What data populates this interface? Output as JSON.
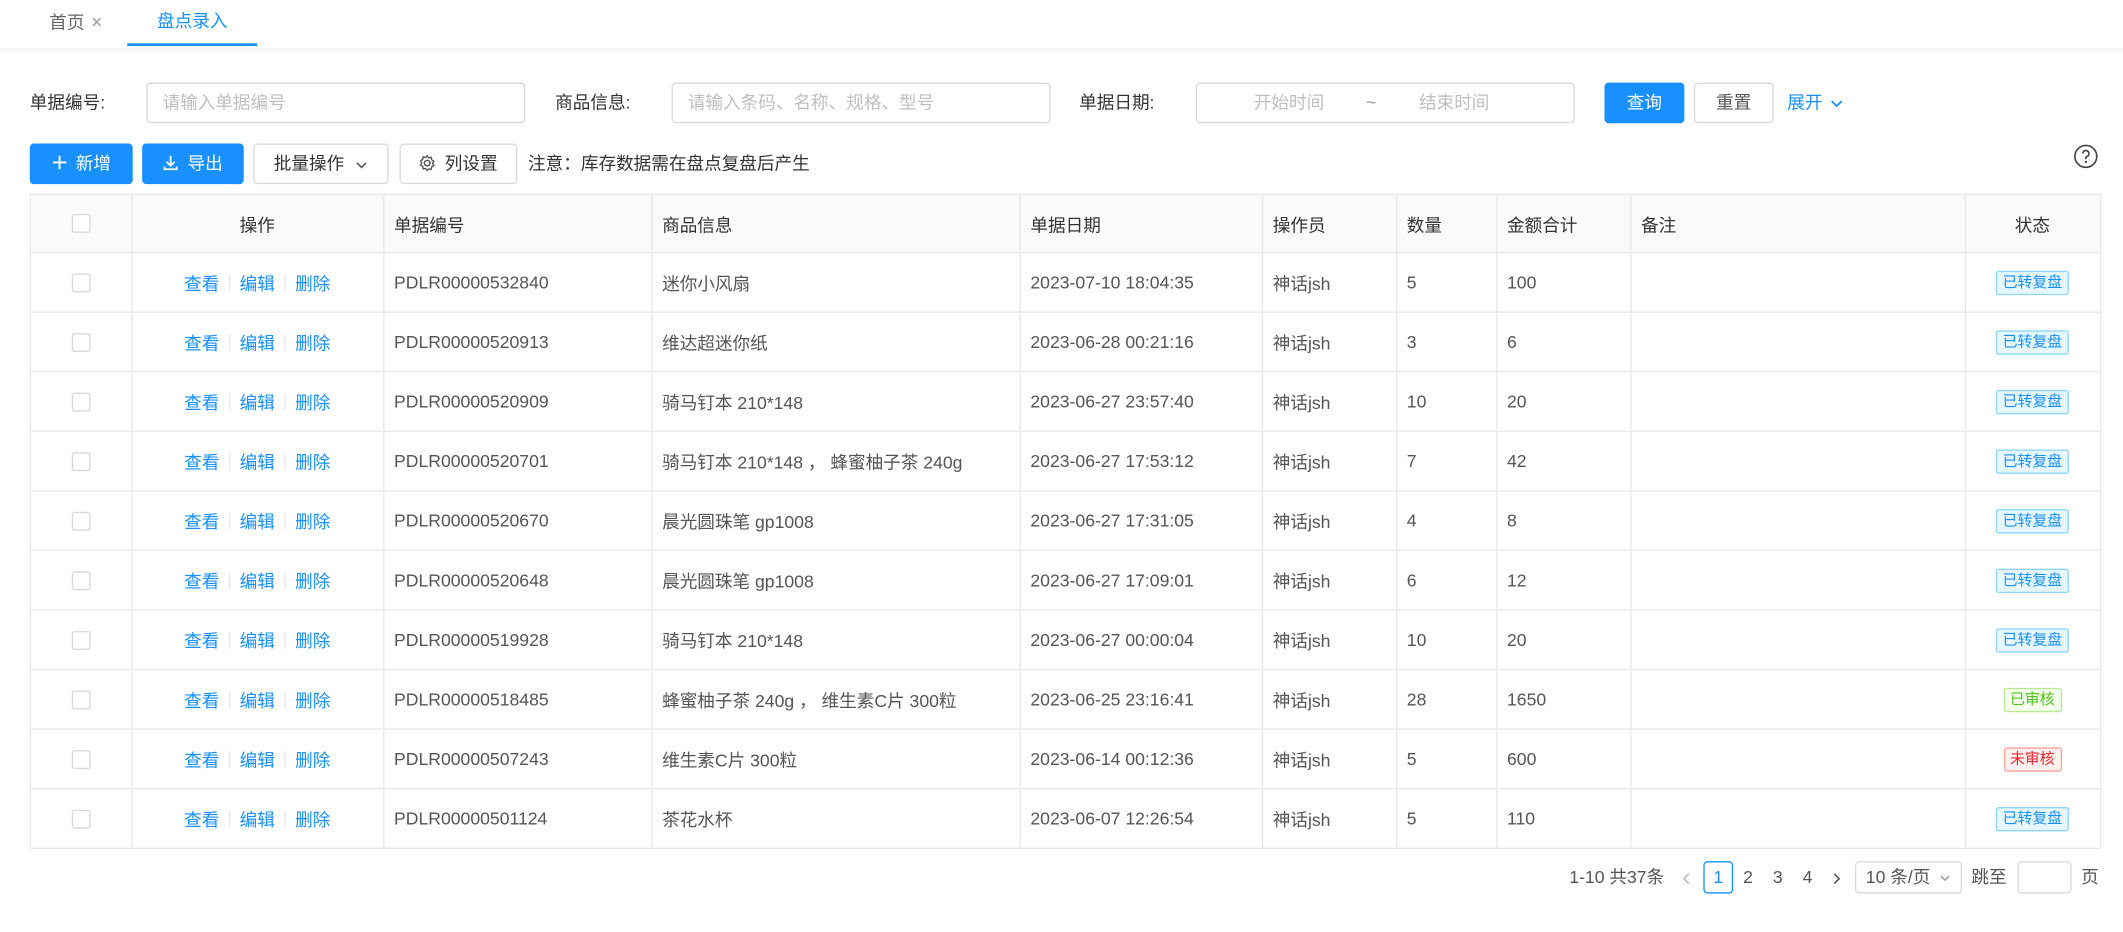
{
  "tabs": [
    {
      "label": "首页"
    },
    {
      "label": "盘点录入"
    }
  ],
  "search": {
    "bill_no_label": "单据编号:",
    "bill_no_placeholder": "请输入单据编号",
    "goods_label": "商品信息:",
    "goods_placeholder": "请输入条码、名称、规格、型号",
    "date_label": "单据日期:",
    "start_placeholder": "开始时间",
    "range_sep": "~",
    "end_placeholder": "结束时间",
    "query_label": "查询",
    "reset_label": "重置",
    "expand_label": "展开"
  },
  "toolbar": {
    "add_label": "新增",
    "export_label": "导出",
    "batch_label": "批量操作",
    "columns_label": "列设置",
    "notice": "注意：库存数据需在盘点复盘后产生"
  },
  "table": {
    "headers": {
      "op": "操作",
      "bill_no": "单据编号",
      "goods": "商品信息",
      "date": "单据日期",
      "operator": "操作员",
      "qty": "数量",
      "amount": "金额合计",
      "remark": "备注",
      "status": "状态"
    },
    "actions": {
      "view": "查看",
      "edit": "编辑",
      "delete": "删除"
    },
    "rows": [
      {
        "bill_no": "PDLR00000532840",
        "goods": "迷你小风扇",
        "date": "2023-07-10 18:04:35",
        "operator": "神话jsh",
        "qty": "5",
        "amount": "100",
        "remark": "",
        "status": "已转复盘",
        "status_color": "blue"
      },
      {
        "bill_no": "PDLR00000520913",
        "goods": "维达超迷你纸",
        "date": "2023-06-28 00:21:16",
        "operator": "神话jsh",
        "qty": "3",
        "amount": "6",
        "remark": "",
        "status": "已转复盘",
        "status_color": "blue"
      },
      {
        "bill_no": "PDLR00000520909",
        "goods": "骑马钉本 210*148",
        "date": "2023-06-27 23:57:40",
        "operator": "神话jsh",
        "qty": "10",
        "amount": "20",
        "remark": "",
        "status": "已转复盘",
        "status_color": "blue"
      },
      {
        "bill_no": "PDLR00000520701",
        "goods": "骑马钉本 210*148 ， 蜂蜜柚子茶 240g",
        "date": "2023-06-27 17:53:12",
        "operator": "神话jsh",
        "qty": "7",
        "amount": "42",
        "remark": "",
        "status": "已转复盘",
        "status_color": "blue"
      },
      {
        "bill_no": "PDLR00000520670",
        "goods": "晨光圆珠笔 gp1008",
        "date": "2023-06-27 17:31:05",
        "operator": "神话jsh",
        "qty": "4",
        "amount": "8",
        "remark": "",
        "status": "已转复盘",
        "status_color": "blue"
      },
      {
        "bill_no": "PDLR00000520648",
        "goods": "晨光圆珠笔 gp1008",
        "date": "2023-06-27 17:09:01",
        "operator": "神话jsh",
        "qty": "6",
        "amount": "12",
        "remark": "",
        "status": "已转复盘",
        "status_color": "blue"
      },
      {
        "bill_no": "PDLR00000519928",
        "goods": "骑马钉本 210*148",
        "date": "2023-06-27 00:00:04",
        "operator": "神话jsh",
        "qty": "10",
        "amount": "20",
        "remark": "",
        "status": "已转复盘",
        "status_color": "blue"
      },
      {
        "bill_no": "PDLR00000518485",
        "goods": "蜂蜜柚子茶 240g ， 维生素C片 300粒",
        "date": "2023-06-25 23:16:41",
        "operator": "神话jsh",
        "qty": "28",
        "amount": "1650",
        "remark": "",
        "status": "已审核",
        "status_color": "green"
      },
      {
        "bill_no": "PDLR00000507243",
        "goods": "维生素C片 300粒",
        "date": "2023-06-14 00:12:36",
        "operator": "神话jsh",
        "qty": "5",
        "amount": "600",
        "remark": "",
        "status": "未审核",
        "status_color": "red"
      },
      {
        "bill_no": "PDLR00000501124",
        "goods": "茶花水杯",
        "date": "2023-06-07 12:26:54",
        "operator": "神话jsh",
        "qty": "5",
        "amount": "110",
        "remark": "",
        "status": "已转复盘",
        "status_color": "blue"
      }
    ]
  },
  "pagination": {
    "total_text": "1-10 共37条",
    "pages": [
      "1",
      "2",
      "3",
      "4"
    ],
    "current": "1",
    "page_size": "10 条/页",
    "jump_label": "跳至",
    "page_suffix": "页"
  },
  "icons": {
    "close": "close-icon",
    "plus": "plus-icon",
    "download": "download-icon",
    "chevron": "chevron-down-icon",
    "gear": "gear-icon",
    "help": "question-circle-icon"
  },
  "colors": {
    "primary": "#1890ff",
    "border": "#e8e8e8",
    "header_bg": "#fafafa"
  }
}
